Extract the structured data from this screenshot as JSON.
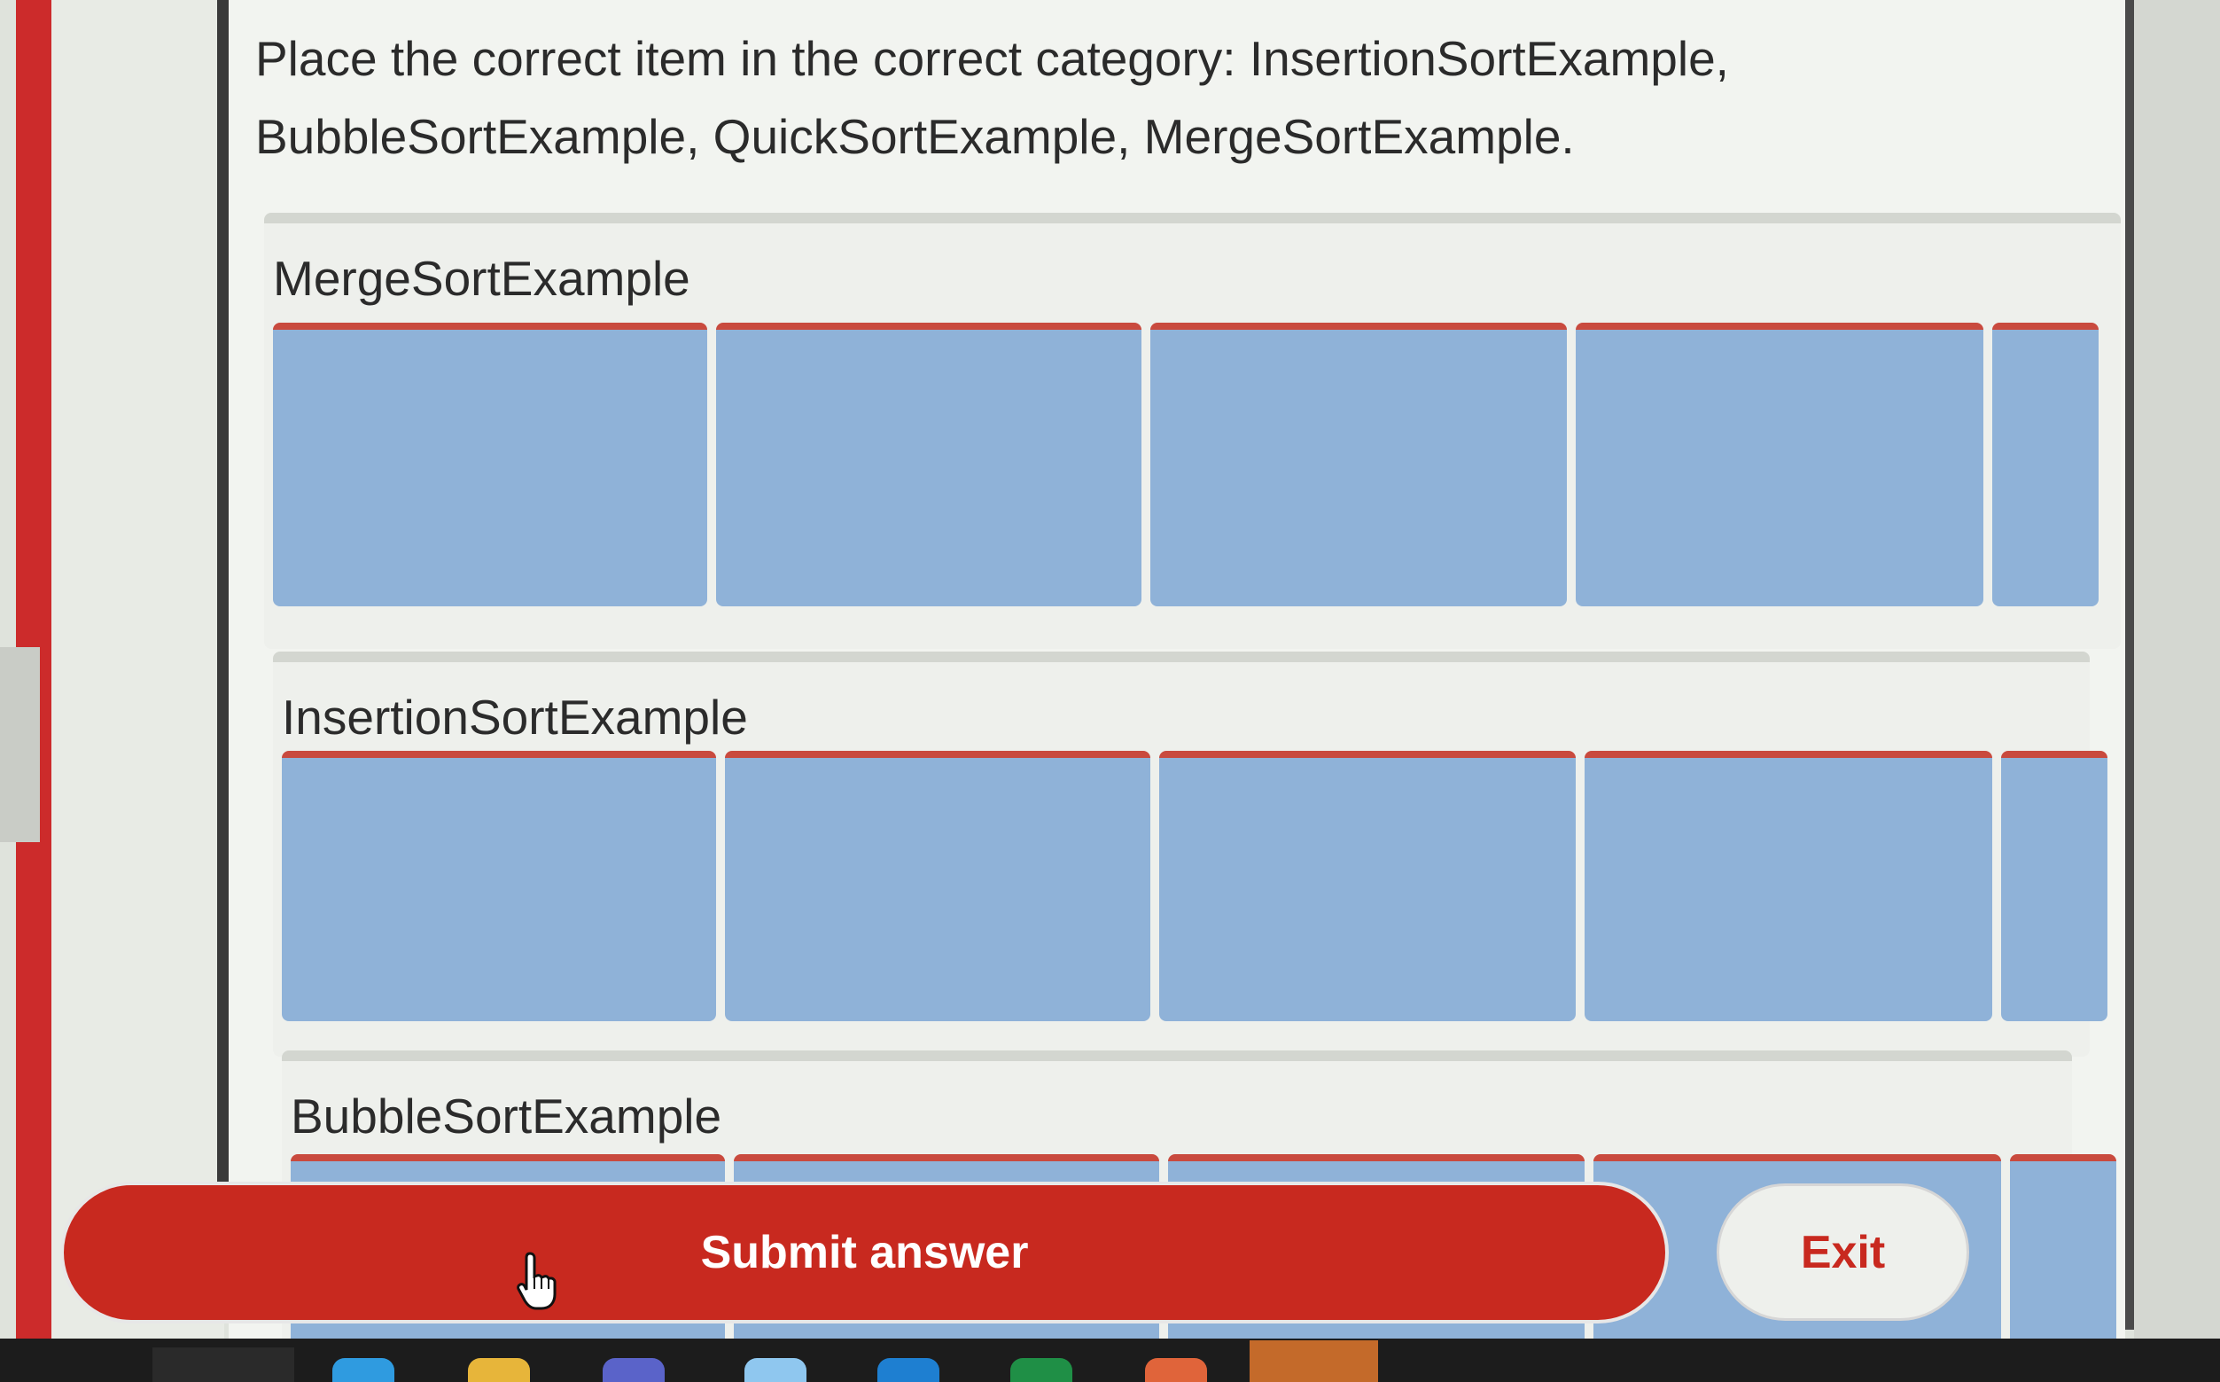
{
  "question": {
    "text": "Place the correct item in the correct category: InsertionSortExample, BubbleSortExample, QuickSortExample, MergeSortExample."
  },
  "categories": [
    {
      "title": "MergeSortExample"
    },
    {
      "title": "InsertionSortExample"
    },
    {
      "title": "BubbleSortExample"
    }
  ],
  "actions": {
    "submit_label": "Submit answer",
    "exit_label": "Exit"
  },
  "colors": {
    "accent_red": "#c8291f",
    "slot_blue": "#8fb2d8"
  },
  "icons": {
    "cursor": "hand-pointer-icon"
  }
}
